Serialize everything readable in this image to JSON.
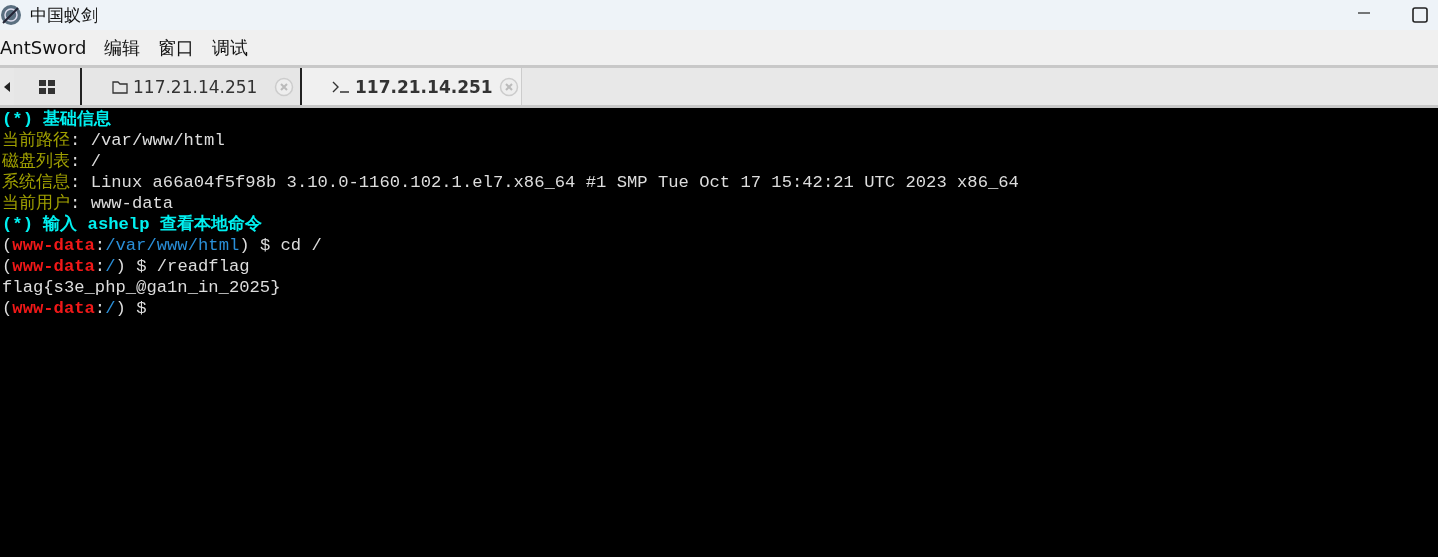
{
  "window": {
    "title": "中国蚁剑"
  },
  "menu": [
    "AntSword",
    "编辑",
    "窗口",
    "调试"
  ],
  "tabs": [
    {
      "kind": "files",
      "label": "117.21.14.251",
      "selected": false
    },
    {
      "kind": "terminal",
      "label": "117.21.14.251",
      "selected": true
    }
  ],
  "terminal": {
    "lines": [
      [
        {
          "kind": "heading",
          "text": "(*) 基础信息"
        }
      ],
      [
        {
          "kind": "label",
          "text": "当前路径"
        },
        {
          "kind": "text",
          "text": ": /var/www/html"
        }
      ],
      [
        {
          "kind": "label",
          "text": "磁盘列表"
        },
        {
          "kind": "text",
          "text": ": /"
        }
      ],
      [
        {
          "kind": "label",
          "text": "系统信息"
        },
        {
          "kind": "text",
          "text": ": Linux a66a04f5f98b 3.10.0-1160.102.1.el7.x86_64 #1 SMP Tue Oct 17 15:42:21 UTC 2023 x86_64"
        }
      ],
      [
        {
          "kind": "label",
          "text": "当前用户"
        },
        {
          "kind": "text",
          "text": ": www-data"
        }
      ],
      [
        {
          "kind": "heading",
          "text": "(*) 输入 ashelp 查看本地命令"
        }
      ],
      [
        {
          "kind": "text",
          "text": "("
        },
        {
          "kind": "user",
          "text": "www-data"
        },
        {
          "kind": "text",
          "text": ":"
        },
        {
          "kind": "path",
          "text": "/var/www/html"
        },
        {
          "kind": "text",
          "text": ") $ cd /"
        }
      ],
      [
        {
          "kind": "text",
          "text": "("
        },
        {
          "kind": "user",
          "text": "www-data"
        },
        {
          "kind": "text",
          "text": ":"
        },
        {
          "kind": "path",
          "text": "/"
        },
        {
          "kind": "text",
          "text": ") $ /readflag"
        }
      ],
      [
        {
          "kind": "text",
          "text": "flag{s3e_php_@ga1n_in_2025}"
        }
      ],
      [
        {
          "kind": "text",
          "text": "("
        },
        {
          "kind": "user",
          "text": "www-data"
        },
        {
          "kind": "text",
          "text": ":"
        },
        {
          "kind": "path",
          "text": "/"
        },
        {
          "kind": "text",
          "text": ") $"
        }
      ]
    ]
  }
}
